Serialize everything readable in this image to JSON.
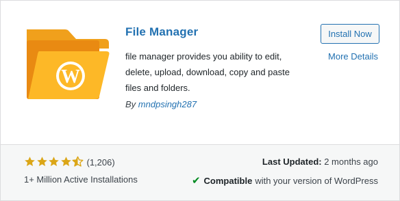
{
  "plugin": {
    "title": "File Manager",
    "description": "file manager provides you ability to edit, delete, upload, download, copy and paste files and folders.",
    "author_prefix": "By",
    "author_name": "mndpsingh287",
    "install_label": "Install Now",
    "more_details_label": "More Details",
    "icon": "wordpress-folder-icon",
    "colors": {
      "folder_back": "#f0a01c",
      "folder_front": "#fdb827",
      "link": "#2271b1",
      "star": "#dba617",
      "check": "#008a20"
    }
  },
  "footer": {
    "rating_value": 4.5,
    "rating_max": 5,
    "rating_count": "(1,206)",
    "installs": "1+ Million Active Installations",
    "last_updated_label": "Last Updated:",
    "last_updated_value": "2 months ago",
    "compat_strong": "Compatible",
    "compat_rest": "with your version of WordPress",
    "check_icon": "checkmark-icon"
  }
}
